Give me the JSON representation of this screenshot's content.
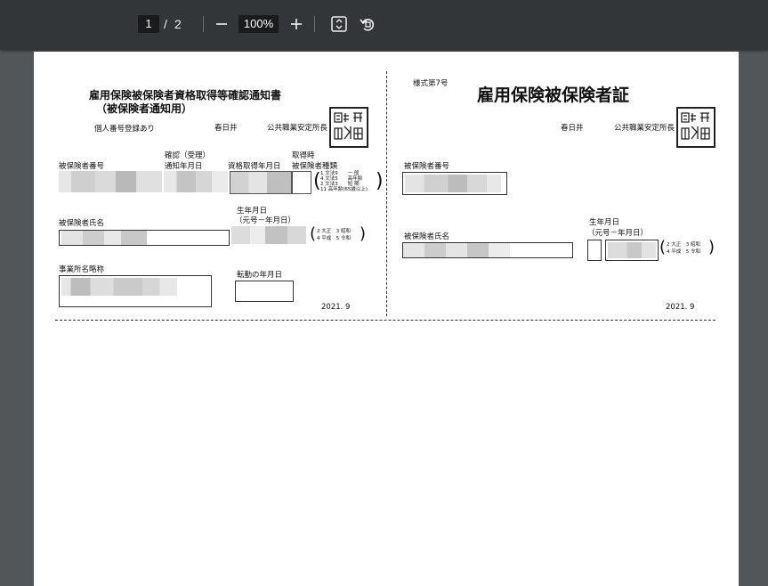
{
  "toolbar": {
    "current_page": "1",
    "page_separator": "/",
    "total_pages": "2",
    "zoom": "100%",
    "icons": [
      "minus-icon",
      "plus-icon",
      "fit-page-icon",
      "rotate-icon"
    ]
  },
  "left": {
    "title1": "雇用保険被保険者資格取得等確認通知書",
    "title2": "（被保険者通知用）",
    "mynumber": "個人番号登録あり",
    "office": "春日井",
    "agency": "公共職業安定所長",
    "insured_no_label": "被保険者番号",
    "confirm_label1": "確認（受理）",
    "confirm_label2": "通知年月日",
    "acq_date_label": "資格取得年月日",
    "type_label1": "取得時",
    "type_label2": "被保険者種類",
    "type_opt1": "1 文法9　　一 般",
    "type_opt2": "4 文法5　　高年齢",
    "type_opt3": "2 文法3　　短 期",
    "type_opt4": "11 高年齢(65歳以上)",
    "name_label": "被保険者氏名",
    "birth_label1": "生年月日",
    "birth_label2": "（元号－年月日）",
    "era1": "2 大正　3 昭和",
    "era2": "4 平成　5 令和",
    "office_name_label": "事業所名略称",
    "transfer_label": "転勤の年月日",
    "form_version": "2021. 9"
  },
  "right": {
    "form_no": "様式第7号",
    "title": "雇用保険被保険者証",
    "office": "春日井",
    "agency": "公共職業安定所長",
    "insured_no_label": "被保険者番号",
    "birth_label1": "生年月日",
    "birth_label2": "（元号－年月日）",
    "name_label": "被保険者氏名",
    "era1": "2 大正　3 昭和",
    "era2": "4 平成　5 令和",
    "form_version": "2021. 9"
  }
}
